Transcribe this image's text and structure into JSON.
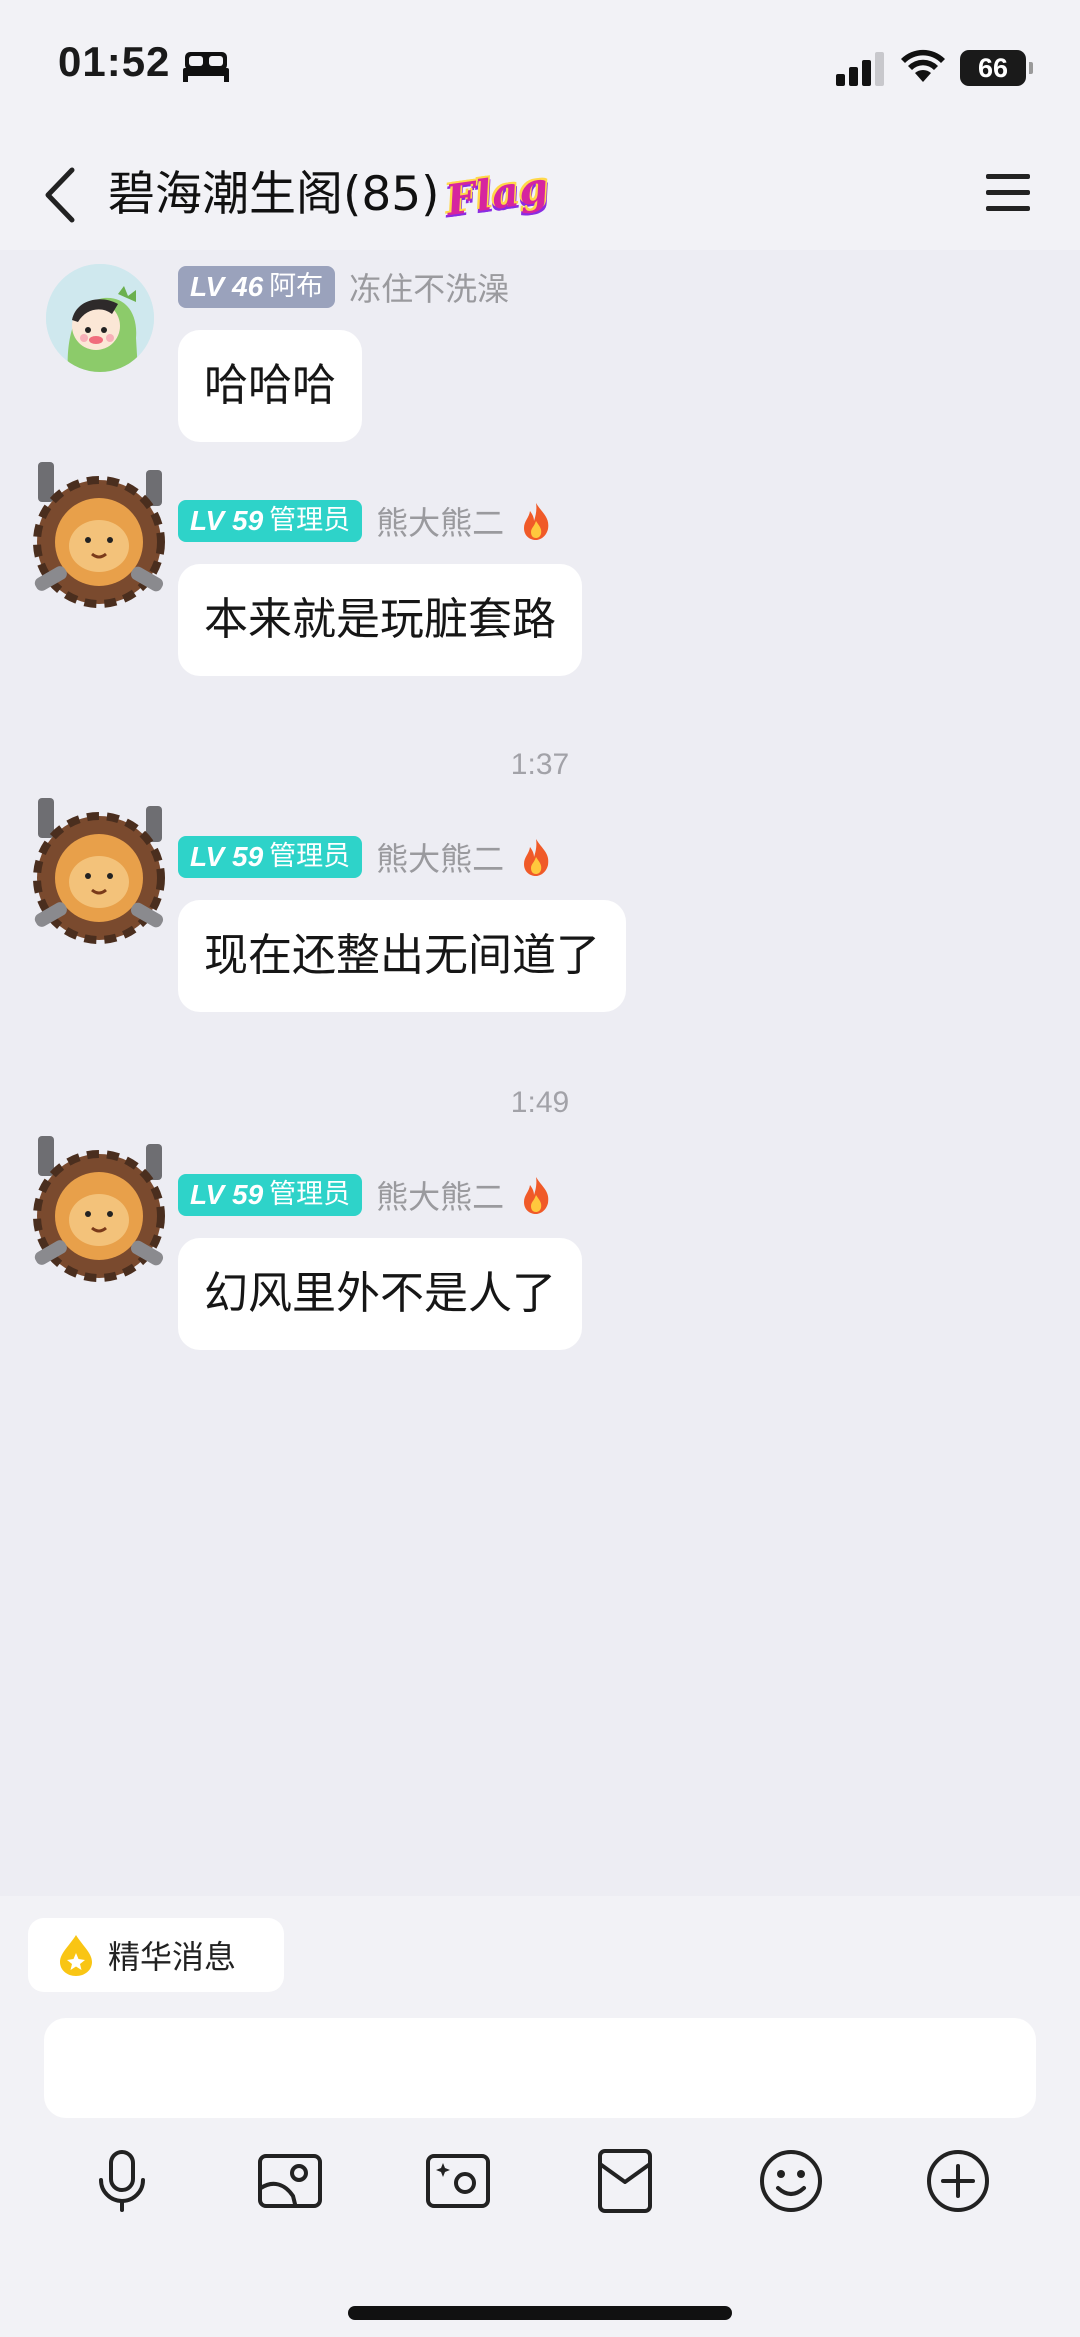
{
  "status_bar": {
    "time": "01:52",
    "battery": "66"
  },
  "header": {
    "title": "碧海潮生阁(85)",
    "badge": "Flag"
  },
  "messages": [
    {
      "level": "LV 46",
      "role": "阿布",
      "sender": "冻住不洗澡",
      "text": "哈哈哈",
      "badge_color": "#9AA2BC"
    },
    {
      "level": "LV 59",
      "role": "管理员",
      "sender": "熊大熊二",
      "text": "本来就是玩脏套路",
      "badge_color": "#2ED3C9"
    },
    {
      "time_before": "1:37",
      "level": "LV 59",
      "role": "管理员",
      "sender": "熊大熊二",
      "text": "现在还整出无间道了",
      "badge_color": "#2ED3C9"
    },
    {
      "time_before": "1:49",
      "level": "LV 59",
      "role": "管理员",
      "sender": "熊大熊二",
      "text": "幻风里外不是人了",
      "badge_color": "#2ED3C9"
    }
  ],
  "bottom": {
    "essence_label": "精华消息",
    "input_placeholder": "",
    "toolbar": [
      "microphone-icon",
      "image-icon",
      "camera-icon",
      "red-packet-icon",
      "emoji-icon",
      "plus-icon"
    ]
  }
}
